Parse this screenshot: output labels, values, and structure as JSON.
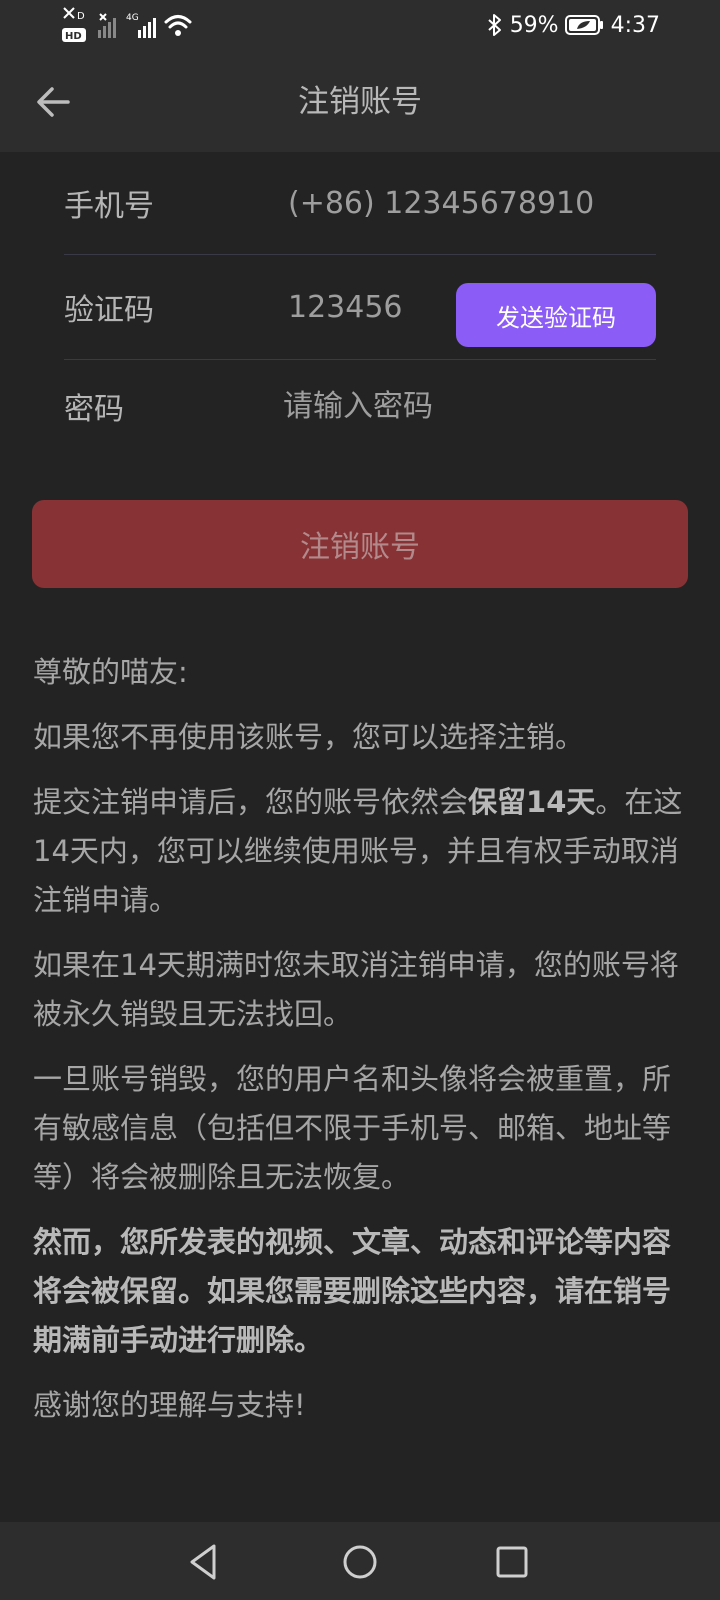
{
  "status_bar": {
    "battery": "59%",
    "time": "4:37",
    "network": "4G",
    "hd_label": "HD",
    "icons": [
      "data-off-icon",
      "signal-off-icon",
      "signal-icon",
      "wifi-icon",
      "bluetooth-icon",
      "battery-icon"
    ]
  },
  "app_bar": {
    "title": "注销账号",
    "back_icon": "arrow-left-icon"
  },
  "form": {
    "phone_label": "手机号",
    "phone_value": "(+86) 12345678910",
    "code_label": "验证码",
    "code_value": "123456",
    "send_code_label": "发送验证码",
    "password_label": "密码",
    "password_placeholder": "请输入密码"
  },
  "cancel_button": "注销账号",
  "notice": {
    "greeting": "尊敬的喵友:",
    "p1": "如果您不再使用该账号，您可以选择注销。",
    "p2_prefix": "提交注销申请后，您的账号依然会",
    "p2_bold": "保留14天",
    "p2_suffix": "。在这14天内，您可以继续使用账号，并且有权手动取消注销申请。",
    "p3": "如果在14天期满时您未取消注销申请，您的账号将被永久销毁且无法找回。",
    "p4": "一旦账号销毁，您的用户名和头像将会被重置，所有敏感信息（包括但不限于手机号、邮箱、地址等等）将会被删除且无法恢复。",
    "p5": "然而，您所发表的视频、文章、动态和评论等内容将会被保留。如果您需要删除这些内容，请在销号期满前手动进行删除。",
    "p6": "感谢您的理解与支持!"
  },
  "nav_bar": {
    "icons": [
      "back-triangle-icon",
      "home-circle-icon",
      "recents-square-icon"
    ]
  },
  "colors": {
    "background": "#232323",
    "bar": "#2d2d2d",
    "accent": "#8b5cf6",
    "danger": "#873235"
  }
}
